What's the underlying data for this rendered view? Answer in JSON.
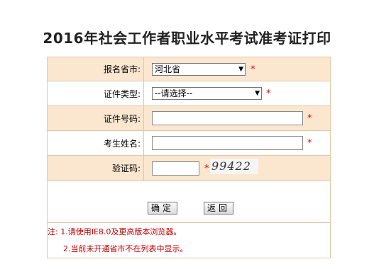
{
  "page_title": "2016年社会工作者职业水平考试准考证打印",
  "form": {
    "province": {
      "label": "报名省市:",
      "value": "河北省"
    },
    "cert_type": {
      "label": "证件类型:",
      "value": "--请选择--"
    },
    "cert_number": {
      "label": "证件号码:",
      "value": ""
    },
    "name": {
      "label": "考生姓名:",
      "value": ""
    },
    "captcha": {
      "label": "验证码:",
      "value": "",
      "image_text": "99422"
    },
    "required_mark": "*"
  },
  "buttons": {
    "confirm": "确定",
    "back": "返回"
  },
  "notes": {
    "line1": "注: 1.请使用IE8.0及更高版本浏览器。",
    "line2": "2.当前未开通省市不在列表中显示。"
  },
  "colors": {
    "row_shade": "#fbe6cf",
    "border": "#e3c7a6",
    "required": "#e00000",
    "note_text": "#c00000"
  }
}
